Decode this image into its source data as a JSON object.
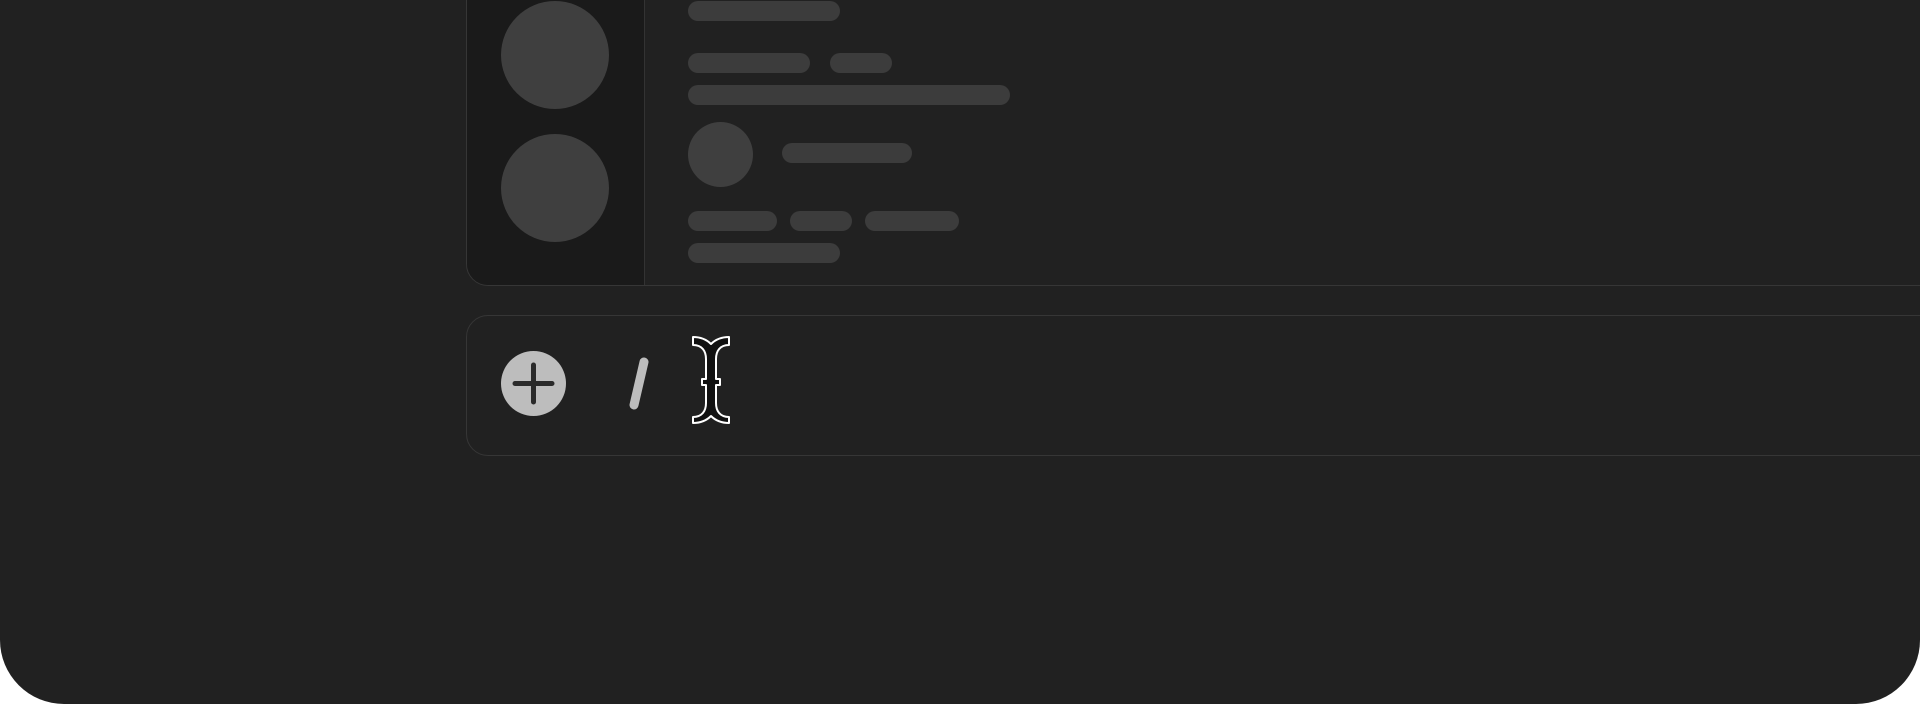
{
  "chat_panel": {
    "server_rail": {
      "avatars": [
        "server-avatar-1",
        "server-avatar-2"
      ]
    },
    "message_list": {
      "placeholder_rows": 5
    }
  },
  "composer": {
    "add_button_icon": "plus-icon",
    "command_hint_icon": "slash-icon",
    "cursor_icon": "text-cursor-icon",
    "input_value": "",
    "input_placeholder": ""
  },
  "colors": {
    "background": "#212121",
    "rail": "#1a1a1a",
    "placeholder": "#3c3c3c",
    "avatar": "#3f3f3f",
    "add_button": "#bdbdbd",
    "border": "#363636"
  }
}
